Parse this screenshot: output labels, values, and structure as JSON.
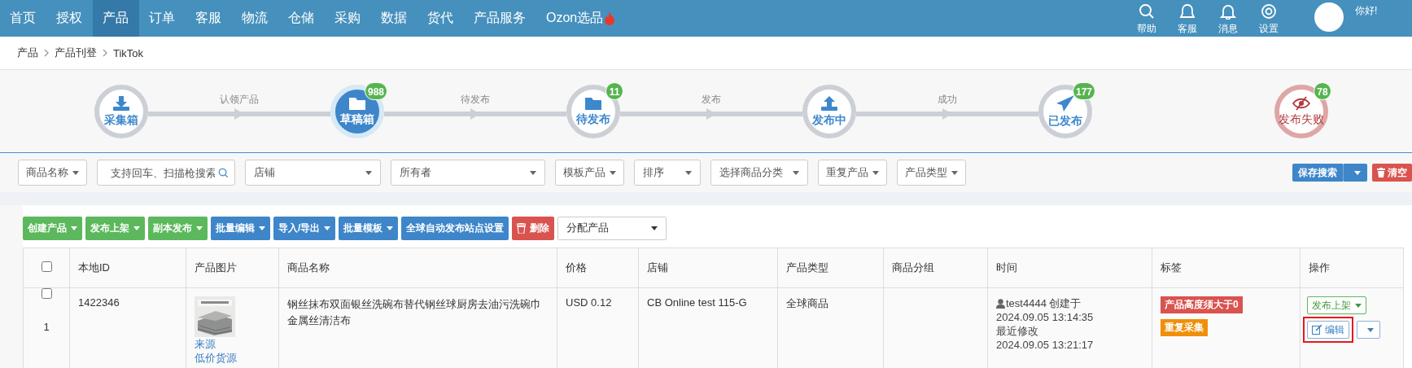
{
  "nav": {
    "items": [
      {
        "label": "首页",
        "selected": false,
        "hot": false
      },
      {
        "label": "授权",
        "selected": false,
        "hot": false
      },
      {
        "label": "产品",
        "selected": true,
        "hot": false
      },
      {
        "label": "订单",
        "selected": false,
        "hot": false
      },
      {
        "label": "客服",
        "selected": false,
        "hot": false
      },
      {
        "label": "物流",
        "selected": false,
        "hot": false
      },
      {
        "label": "仓储",
        "selected": false,
        "hot": false
      },
      {
        "label": "采购",
        "selected": false,
        "hot": false
      },
      {
        "label": "数据",
        "selected": false,
        "hot": false
      },
      {
        "label": "货代",
        "selected": false,
        "hot": false
      },
      {
        "label": "产品服务",
        "selected": false,
        "hot": false
      },
      {
        "label": "Ozon选品",
        "selected": false,
        "hot": true
      }
    ],
    "tools": [
      {
        "label": "帮助"
      },
      {
        "label": "客服"
      },
      {
        "label": "消息"
      },
      {
        "label": "设置"
      }
    ],
    "greeting": "你好!"
  },
  "breadcrumb": [
    "产品",
    "产品刊登",
    "TikTok"
  ],
  "steps": [
    {
      "label": "采集箱",
      "failed": false,
      "selected": false
    },
    {
      "label": "草稿箱",
      "failed": false,
      "selected": true,
      "count": "988"
    },
    {
      "label": "待发布",
      "failed": false,
      "selected": false,
      "count": "11"
    },
    {
      "label": "发布中",
      "failed": false,
      "selected": false
    },
    {
      "label": "已发布",
      "failed": false,
      "selected": false,
      "count": "177"
    },
    {
      "label": "发布失败",
      "failed": true,
      "selected": false,
      "count": "78"
    }
  ],
  "step_links": [
    "认领产品",
    "待发布",
    "发布",
    "成功"
  ],
  "filters": [
    {
      "kind": "dropdown",
      "label": "商品名称"
    },
    {
      "kind": "search",
      "placeholder": "支持回车、扫描枪搜索"
    },
    {
      "kind": "select",
      "placeholder": "店铺"
    },
    {
      "kind": "select",
      "placeholder": "所有者"
    },
    {
      "kind": "dropdown",
      "label": "模板产品"
    },
    {
      "kind": "select",
      "placeholder": "排序"
    },
    {
      "kind": "select",
      "placeholder": "选择商品分类"
    },
    {
      "kind": "dropdown",
      "label": "重复产品"
    },
    {
      "kind": "dropdown",
      "label": "产品类型"
    }
  ],
  "filter_actions": [
    {
      "kind": "split",
      "label": "保存搜索"
    },
    {
      "kind": "danger",
      "label": "清空"
    }
  ],
  "toolbar": [
    {
      "kind": "success",
      "label": "创建产品",
      "caret": true
    },
    {
      "kind": "success",
      "label": "发布上架",
      "caret": true
    },
    {
      "kind": "success",
      "label": "副本发布",
      "caret": true
    },
    {
      "kind": "primary",
      "label": "批量编辑",
      "caret": true
    },
    {
      "kind": "primary",
      "label": "导入/导出",
      "caret": true
    },
    {
      "kind": "primary",
      "label": "批量模板",
      "caret": true
    },
    {
      "kind": "primary",
      "label": "全球自动发布站点设置",
      "caret": false
    },
    {
      "kind": "danger",
      "label": "删除",
      "caret": false
    },
    {
      "kind": "select",
      "label": "分配产品",
      "caret": true
    }
  ],
  "table": {
    "header_checked": false,
    "columns": [
      "本地ID",
      "产品图片",
      "商品名称",
      "价格",
      "店铺",
      "产品类型",
      "商品分组",
      "时间",
      "标签",
      "操作"
    ],
    "rows": [
      {
        "checked": false,
        "index": "1",
        "id": "1422346",
        "links": [
          "来源",
          "低价货源"
        ],
        "name": "钢丝抹布双面银丝洗碗布替代钢丝球厨房去油污洗碗巾金属丝清洁布",
        "price": "USD 0.12",
        "shop": "CB Online test 115-G",
        "type": "全球商品",
        "creator": "test4444",
        "created_label": "创建于",
        "created": "2024.09.05 13:14:35",
        "modified_label": "最近修改",
        "modified": "2024.09.05 13:21:17",
        "tags": [
          {
            "label": "产品高度须大于0",
            "color": "#d9534f"
          },
          {
            "label": "重复采集",
            "color": "#f0900a"
          }
        ],
        "publish": "发布上架",
        "edit": "编辑",
        "edit_highlighted": true
      }
    ]
  }
}
